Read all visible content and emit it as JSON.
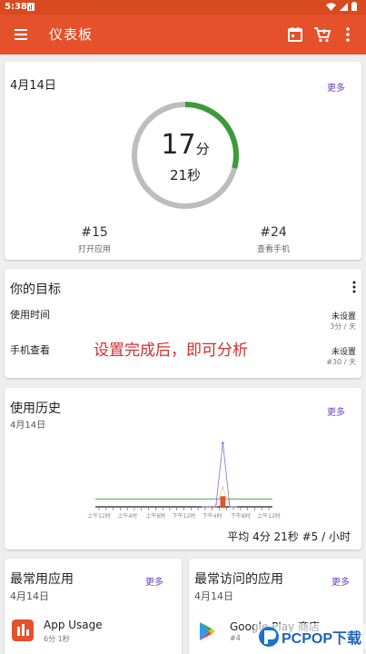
{
  "status_bar": {
    "time": "5:38"
  },
  "app_bar": {
    "title": "仪表板",
    "icons": [
      "menu-icon",
      "calendar-icon",
      "cart-icon",
      "more-vert-icon"
    ]
  },
  "colors": {
    "app_bar": "#e5512a",
    "accent_link": "#6a3fb8",
    "ring_progress": "#3a9b3a",
    "ring_track": "#bdbdbd",
    "alert_text": "#d32f2f"
  },
  "today": {
    "date": "4月14日",
    "more": "更多",
    "minutes": "17",
    "minutes_unit": "分",
    "seconds_text": "21秒",
    "ring_progress_fraction": 0.29,
    "stats": [
      {
        "value": "#15",
        "label": "打开应用"
      },
      {
        "value": "#24",
        "label": "查看手机"
      }
    ]
  },
  "goals": {
    "title": "你的目标",
    "rows": [
      {
        "label": "使用时间",
        "status": "未设置",
        "sub": "3分 / 天"
      },
      {
        "label": "手机查看",
        "status": "未设置",
        "sub": "#30 / 天"
      }
    ],
    "overlay_message": "设置完成后，即可分析"
  },
  "history": {
    "title": "使用历史",
    "date": "4月14日",
    "more": "更多",
    "average": "平均 4分 21秒 #5 / 小时"
  },
  "chart_data": {
    "type": "bar",
    "x_tick_labels": [
      "上午12时",
      "上午4时",
      "上午8时",
      "下午12时",
      "下午4时",
      "下午8时",
      "上午12时"
    ],
    "hours": [
      0,
      1,
      2,
      3,
      4,
      5,
      6,
      7,
      8,
      9,
      10,
      11,
      12,
      13,
      14,
      15,
      16,
      17,
      18,
      19,
      20,
      21,
      22,
      23
    ],
    "series": [
      {
        "values": [
          0,
          0,
          0,
          0,
          0,
          0,
          0,
          0,
          0,
          0,
          0,
          0,
          0,
          0,
          0,
          0,
          0,
          2.5,
          0,
          0,
          0,
          0,
          0,
          0
        ]
      },
      {
        "values": [
          0,
          0,
          0,
          0,
          0,
          0,
          0,
          0,
          0,
          0,
          0,
          0,
          0,
          0,
          0,
          0.1,
          0.2,
          4.5,
          0,
          0,
          0,
          0,
          0,
          0
        ]
      },
      {
        "values": [
          0,
          0,
          0,
          0,
          0,
          0,
          0,
          0,
          0,
          0,
          0,
          0,
          0,
          0,
          0,
          0,
          0,
          15,
          0,
          0,
          0,
          0,
          0,
          0
        ]
      }
    ],
    "ylim": [
      0,
      16
    ],
    "reference_line": 1,
    "colors": [
      "#e5512a",
      "#f0c8a8",
      "#8b6bd6"
    ],
    "grid": false
  },
  "top_apps": {
    "title": "最常用应用",
    "date": "4月14日",
    "more": "更多",
    "items": [
      {
        "name": "App Usage",
        "sub": "6分 1秒"
      }
    ]
  },
  "top_visited": {
    "title": "最常访问的应用",
    "date": "4月14日",
    "more": "更多",
    "items": [
      {
        "name": "Google Play 商店",
        "sub": "#4"
      }
    ]
  },
  "watermark": {
    "text": "PCPOP下载"
  }
}
